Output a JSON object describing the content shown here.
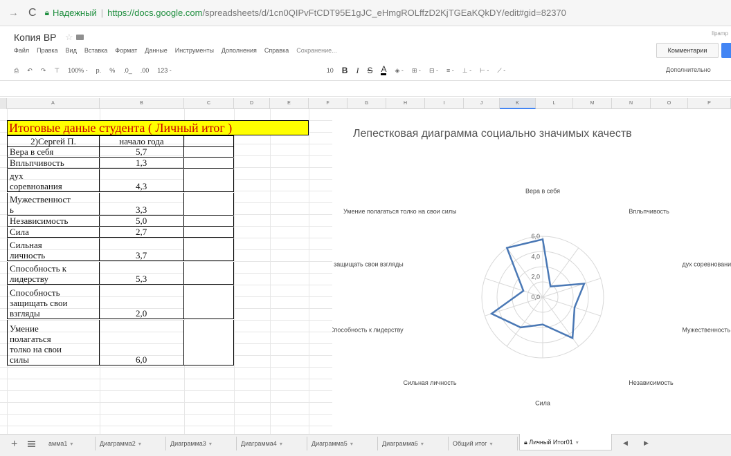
{
  "browser": {
    "secure_label": "Надежный",
    "url_host": "https://docs.google.com",
    "url_path": "/spreadsheets/d/1cn0QIPvFtCDT95E1gJC_eHmgROLffzD2KjTGEaKQkDY/edit#gid=82370"
  },
  "app": {
    "title": "Копия ВР",
    "user_hint": "Ilpamp",
    "menu": [
      "Файл",
      "Правка",
      "Вид",
      "Вставка",
      "Формат",
      "Данные",
      "Инструменты",
      "Дополнения",
      "Справка"
    ],
    "saving": "Сохранение...",
    "comments_label": "Комментарии"
  },
  "toolbar": {
    "zoom": "100% -",
    "currency": "р.",
    "percent": "%",
    "dec_less": ".0_",
    "dec_more": ".00",
    "format": "123 -",
    "font_size": "10",
    "bold": "B",
    "italic": "I",
    "strike": "S",
    "textcolor": "A",
    "more": "Дополнительно"
  },
  "columns": [
    "A",
    "B",
    "C",
    "D",
    "E",
    "F",
    "G",
    "H",
    "I",
    "J",
    "K",
    "L",
    "M",
    "N",
    "O",
    "P"
  ],
  "table": {
    "title": "Итоговые даные студента ( Личный итог )",
    "header_name": "2)Сергей П.",
    "header_value": "начало года",
    "rows": [
      {
        "name": "Вера в себя",
        "value": "5,7"
      },
      {
        "name": "Впльпчивость",
        "value": "1,3"
      },
      {
        "name_lines": [
          "дух",
          "соревнования"
        ],
        "value": "4,3"
      },
      {
        "name_lines": [
          "Мужественност",
          "ь"
        ],
        "value": "3,3"
      },
      {
        "name": "Независимость",
        "value": "5,0"
      },
      {
        "name": "Сила",
        "value": "2,7"
      },
      {
        "name_lines": [
          "Сильная",
          "личность"
        ],
        "value": "3,7"
      },
      {
        "name_lines": [
          "Способность к",
          "лидерству"
        ],
        "value": "5,3"
      },
      {
        "name_lines": [
          "Способность",
          "защищать свои",
          "взгляды"
        ],
        "value": "2,0"
      },
      {
        "name_lines": [
          "Умение",
          "полагаться",
          "толко на свои",
          "силы"
        ],
        "value": "6,0"
      }
    ]
  },
  "chart_data": {
    "type": "radar",
    "title": "Лепестковая  диаграмма социально значимых качеств",
    "categories": [
      "Вера в себя",
      "Впльпчивость",
      "дух соревнования",
      "Мужественность",
      "Независимость",
      "Сила",
      "Сильная личность",
      "Способность к лидерству",
      "Способность защищать свои взгляды",
      "Умение полагаться толко на свои силы"
    ],
    "series": [
      {
        "values": [
          5.7,
          1.3,
          4.3,
          3.3,
          5.0,
          2.7,
          3.7,
          5.3,
          2.0,
          6.0
        ]
      }
    ],
    "ticks": [
      "6,0",
      "4,0",
      "2,0",
      "0,0"
    ],
    "rmax": 6,
    "colors": {
      "line": "#4a78b5",
      "grid": "#d8d8d8"
    }
  },
  "sheets": {
    "tabs": [
      "амма1",
      "Диаграмма2",
      "Диаграмма3",
      "Диаграмма4",
      "Диаграмма5",
      "Диаграмма6",
      "Общий итог",
      "Личный Итог01"
    ],
    "active": "Личный Итог01"
  }
}
